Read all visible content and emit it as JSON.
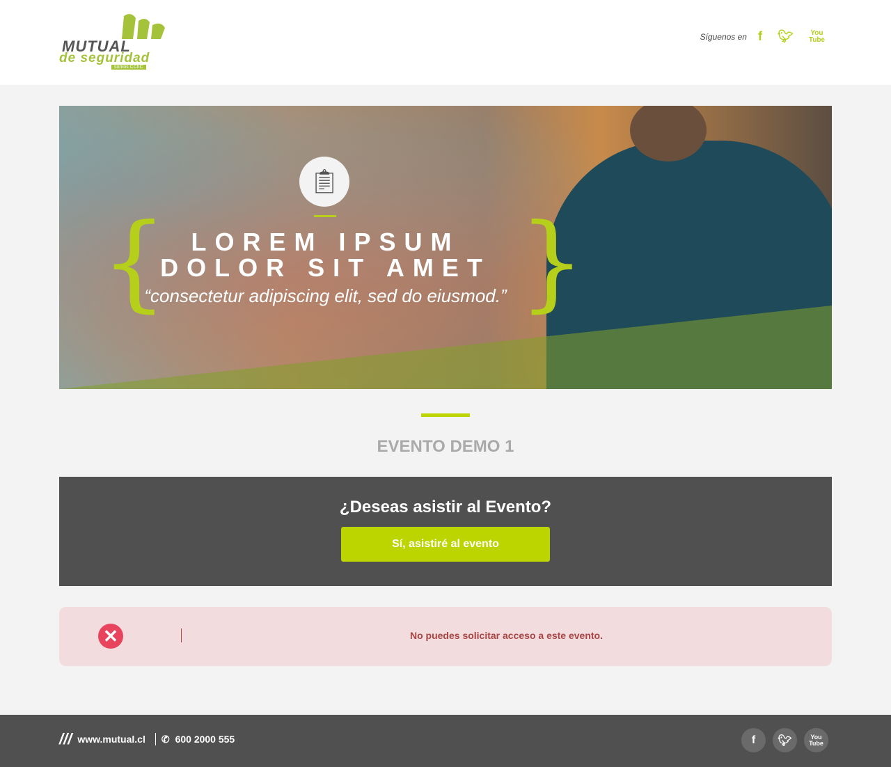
{
  "header": {
    "logo_text": "MUTUAL de seguridad somos CChC",
    "follow_label": "Síguenos en",
    "social": [
      "facebook-icon",
      "twitter-icon",
      "youtube-icon"
    ]
  },
  "banner": {
    "line1": "LOREM IPSUM",
    "line2": "DOLOR SIT AMET",
    "quote": "“consectetur adipiscing elit, sed do eiusmod.”"
  },
  "event": {
    "title": "EVENTO DEMO 1",
    "question": "¿Deseas asistir al Evento?",
    "button": "Sí, asistiré al evento"
  },
  "alert": {
    "message": "No puedes solicitar acceso a este evento."
  },
  "footer": {
    "website": "www.mutual.cl",
    "phone": "600 2000 555"
  },
  "colors": {
    "accent": "#bcd400",
    "dark": "#505050",
    "error": "#a94442"
  }
}
